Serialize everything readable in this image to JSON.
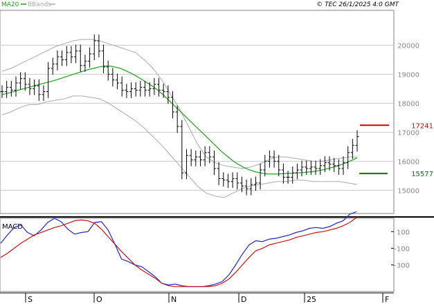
{
  "header": {
    "indicator_ma": "MA20",
    "indicator_bb": "BBands",
    "ma_color": "#19a319",
    "bb_color": "#aaaaaa",
    "copyright": "© TEC 26/1/2025 4:0 GMT"
  },
  "colors": {
    "price_bar": "#000000",
    "macd_line": "#2222cc",
    "signal_line": "#cc1111",
    "grid": "#c8c8c8",
    "resistance": "#cc0000",
    "support": "#007700"
  },
  "chart_data": [
    {
      "type": "line",
      "title": "",
      "x": [
        "Sep",
        "Oct",
        "Nov",
        "Dec",
        "25",
        "Feb"
      ],
      "xticks": [
        "S",
        "O",
        "N",
        "D",
        "25",
        "F"
      ],
      "yticks": [
        "15000",
        "16000",
        "17000",
        "18000",
        "19000",
        "20000"
      ],
      "ylim": [
        14200,
        21200
      ],
      "grid": true,
      "series": [
        {
          "name": "MA20"
        },
        {
          "name": "BBands"
        }
      ],
      "close": [
        18400,
        18550,
        18450,
        18700,
        18850,
        18650,
        18500,
        18600,
        18300,
        18400,
        19200,
        19350,
        19600,
        19500,
        19750,
        19600,
        19800,
        19300,
        19450,
        19700,
        20150,
        19800,
        19250,
        19000,
        18800,
        18700,
        18450,
        18400,
        18500,
        18450,
        18550,
        18450,
        18500,
        18650,
        18450,
        18400,
        18200,
        17700,
        17200,
        15600,
        16200,
        16050,
        16150,
        16050,
        16300,
        16150,
        15750,
        15400,
        15350,
        15300,
        15400,
        15250,
        15150,
        15050,
        15200,
        15250,
        15700,
        16000,
        16150,
        16000,
        15700,
        15450,
        15450,
        15600,
        15700,
        15800,
        15750,
        15800,
        15750,
        15850,
        15950,
        15900,
        15850,
        15750,
        15950,
        16300,
        16550,
        16850
      ],
      "ma": [
        18300,
        18340,
        18390,
        18450,
        18500,
        18550,
        18600,
        18650,
        18700,
        18750,
        18800,
        18860,
        18920,
        18980,
        19040,
        19100,
        19160,
        19200,
        19250,
        19280,
        19280,
        19250,
        19200,
        19120,
        19030,
        18930,
        18820,
        18700,
        18580,
        18440,
        18280,
        18100,
        17920,
        17740,
        17560,
        17380,
        17200,
        17020,
        16840,
        16660,
        16480,
        16300,
        16150,
        16000,
        15880,
        15780,
        15700,
        15640,
        15600,
        15570,
        15560,
        15560,
        15570,
        15580,
        15590,
        15600,
        15615,
        15630,
        15650,
        15680,
        15720,
        15770,
        15820,
        15880,
        15950,
        16030,
        16120
      ],
      "bb_upper": [
        19100,
        19200,
        19350,
        19500,
        19650,
        19800,
        19950,
        20050,
        20150,
        20200,
        20200,
        20150,
        20050,
        19950,
        19850,
        19750,
        19500,
        19200,
        18800,
        18300,
        17800,
        17200,
        16600,
        16150,
        15950,
        15850,
        15800,
        15750,
        15800,
        15900,
        16050,
        16150,
        16150,
        16100,
        16050,
        16000,
        16000,
        16050,
        16100,
        16150,
        16150
      ],
      "bb_lower": [
        17600,
        17700,
        17850,
        17950,
        17950,
        18050,
        18100,
        18150,
        18250,
        18250,
        18200,
        18150,
        18000,
        17800,
        17600,
        17400,
        17150,
        16850,
        16550,
        16200,
        15850,
        15500,
        15150,
        14900,
        14800,
        14750,
        14900,
        15050,
        15150,
        15200,
        15250,
        15300,
        15300,
        15350,
        15350,
        15300,
        15300,
        15300,
        15300,
        15250,
        15200
      ],
      "levels": [
        {
          "label": "17241",
          "value": 17241
        },
        {
          "label": "15577",
          "value": 15577
        }
      ]
    },
    {
      "type": "line",
      "title": "MACD",
      "yticks": [
        "100",
        "-100",
        "-300"
      ],
      "ylim": [
        -620,
        260
      ],
      "grid": false,
      "series": [
        {
          "name": "MACD",
          "values": [
            -40,
            60,
            150,
            180,
            90,
            50,
            120,
            210,
            260,
            220,
            130,
            70,
            90,
            100,
            210,
            220,
            120,
            -50,
            -230,
            -260,
            -300,
            -320,
            -380,
            -440,
            -520,
            -540,
            -530,
            -550,
            -560,
            -560,
            -560,
            -550,
            -530,
            -500,
            -420,
            -300,
            -170,
            -60,
            -10,
            -20,
            10,
            20,
            40,
            60,
            90,
            110,
            140,
            150,
            140,
            160,
            200,
            230,
            310,
            340
          ]
        },
        {
          "name": "Signal",
          "values": [
            -210,
            -160,
            -100,
            -40,
            10,
            60,
            90,
            120,
            150,
            170,
            200,
            230,
            240,
            230,
            200,
            130,
            40,
            -50,
            -140,
            -220,
            -300,
            -360,
            -410,
            -460,
            -520,
            -550,
            -560,
            -560,
            -560,
            -560,
            -560,
            -560,
            -550,
            -520,
            -470,
            -390,
            -300,
            -210,
            -130,
            -100,
            -60,
            -40,
            -20,
            0,
            30,
            50,
            70,
            90,
            100,
            120,
            140,
            170,
            210,
            270
          ]
        }
      ]
    }
  ]
}
